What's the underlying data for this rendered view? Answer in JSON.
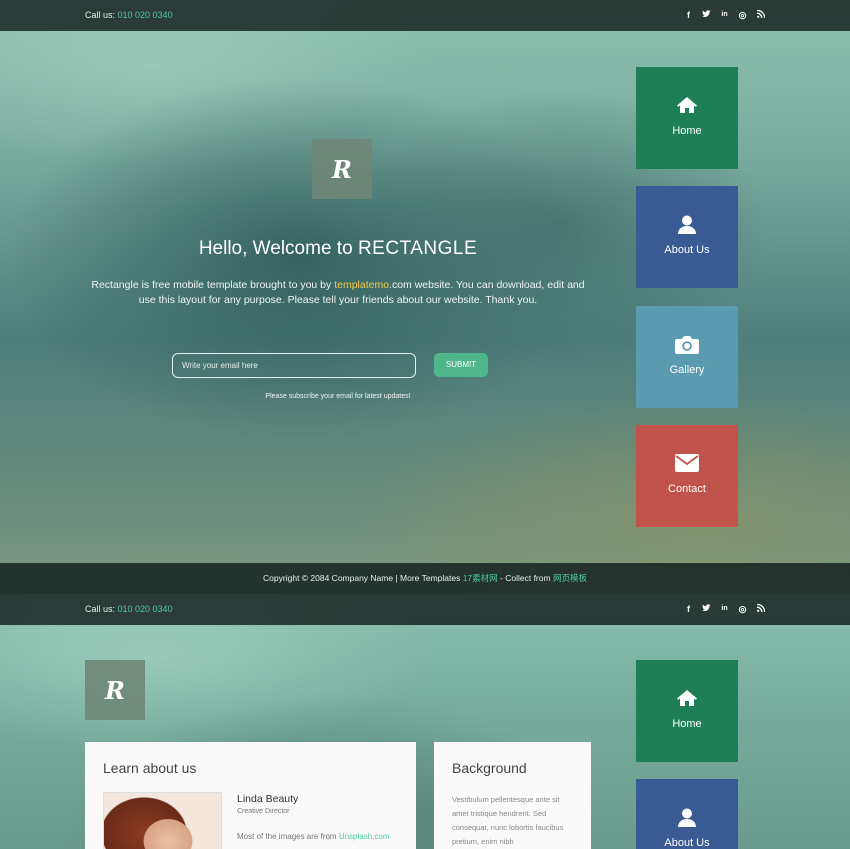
{
  "topbar": {
    "call_label": "Call us: ",
    "phone": "010 020 0340",
    "socials": [
      {
        "icon": "facebook-icon",
        "glyph": "f"
      },
      {
        "icon": "twitter-icon",
        "glyph": "t"
      },
      {
        "icon": "linkedin-icon",
        "glyph": "in"
      },
      {
        "icon": "dribbble-icon",
        "glyph": "◎"
      },
      {
        "icon": "rss-icon",
        "glyph": "))"
      }
    ]
  },
  "logo": {
    "letter": "R"
  },
  "hero": {
    "title_prefix": "Hello, Welcome to ",
    "title_brand": "RECTANGLE",
    "text_before": "Rectangle is free mobile template brought to you by ",
    "text_link": "templatemo",
    "text_after": ".com website. You can download, edit and use this layout for any purpose. Please tell your friends about our website. Thank you.",
    "email_placeholder": "Write your email here",
    "submit_label": "SUBMIT",
    "note": "Please subscribe your email for latest updates!"
  },
  "nav": {
    "home": "Home",
    "about": "About Us",
    "gallery": "Gallery",
    "contact": "Contact"
  },
  "footer": {
    "copyright": "Copyright © 2084 Company Name | More Templates ",
    "templates_link": "17素材网",
    "collect_text": " - Collect from ",
    "collect_link": "网页模板"
  },
  "about": {
    "heading": "Learn about us",
    "name": "Linda Beauty",
    "role": "Creative Director",
    "text_before": "Most of the images are from ",
    "text_link": "Unsplash.com"
  },
  "background": {
    "heading": "Background",
    "text": "Vestibulum pellentesque ante sit amet tristique hendrerit. Sed consequat, nunc lobortis faucibus pretium, enim nibh"
  },
  "colors": {
    "home_tile": "#1e7f57",
    "about_tile": "#3a5a93",
    "gallery_tile": "#5a9bb0",
    "contact_tile": "#c0534b",
    "accent": "#4ec9a3",
    "link_yellow": "#f2c94c"
  }
}
